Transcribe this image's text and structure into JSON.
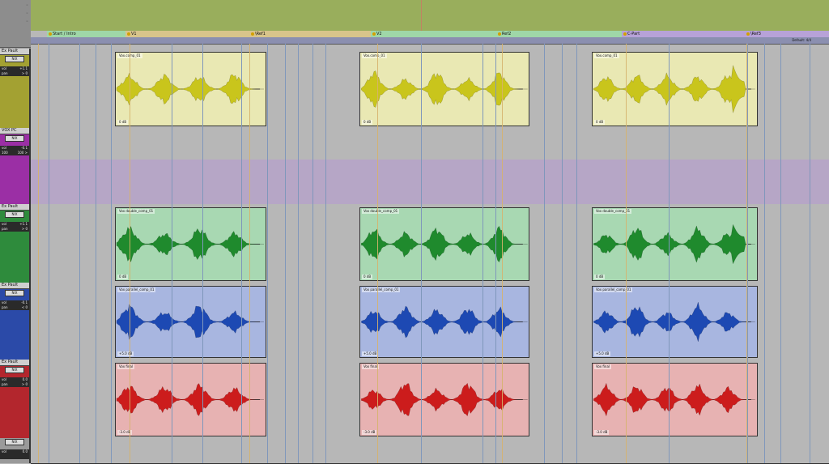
{
  "header": {
    "button_a": "◦",
    "button_b": "◦",
    "button_c": "◦"
  },
  "markers": [
    {
      "label": "Start / Intro",
      "color": "#9fd7a8"
    },
    {
      "label": "V1",
      "color": "#d8c48b"
    },
    {
      "label": "\\Ref1",
      "color": "#d8c48b"
    },
    {
      "label": "V2",
      "color": "#9fd7a8"
    },
    {
      "label": "Ref2",
      "color": "#9fd7a8"
    },
    {
      "label": "C-Part",
      "color": "#b7a2d8"
    },
    {
      "label": "\\Ref3",
      "color": "#b7a2d8"
    }
  ],
  "bar_label": "Default: 4/4",
  "tracks": [
    {
      "name": "Ex Pault",
      "mode": "NIX",
      "vol_label": "vol",
      "vol": "+1.1",
      "pan_label": "pan",
      "pan": "> 0",
      "color": "#a3a132",
      "lane_bg": "#b7b7b7"
    },
    {
      "name": "VOX PC",
      "mode": "NIX",
      "vol_label": "vol",
      "vol": "-0.1",
      "pan_label": "100",
      "pan": "100 >",
      "color": "#9b2fa5",
      "lane_bg": "#b7b7b7"
    },
    {
      "name": "",
      "mode": "",
      "vol_label": "",
      "vol": "",
      "pan_label": "",
      "pan": "",
      "color": "#9b2fa5",
      "lane_bg": "#b6a6c6"
    },
    {
      "name": "Ex Pault",
      "mode": "NIX",
      "vol_label": "vol",
      "vol": "+1.1",
      "pan_label": "pan",
      "pan": "> 0",
      "color": "#2e8b3c",
      "lane_bg": "#b7b7b7"
    },
    {
      "name": "Ex Pault",
      "mode": "NIX",
      "vol_label": "vol",
      "vol": "-0.1",
      "pan_label": "pan",
      "pan": "< 0",
      "color": "#2b4aa8",
      "lane_bg": "#b7b7b7"
    },
    {
      "name": "Ex Pault",
      "mode": "NIX",
      "vol_label": "vol",
      "vol": "0.0",
      "pan_label": "pan",
      "pan": "> 0",
      "color": "#b3262d",
      "lane_bg": "#b7b7b7"
    },
    {
      "name": "",
      "mode": "NIX",
      "vol_label": "vol",
      "vol": "0.0",
      "pan_label": "",
      "pan": "",
      "color": "#9a9a9a",
      "lane_bg": "#b7b7b7"
    }
  ],
  "clips": {
    "yellow": [
      {
        "name": "Vox.comp_01",
        "gain": "0 dB",
        "fill": "#e9e8b3",
        "wave": "#c9c51c"
      },
      {
        "name": "Vox.comp_01",
        "gain": "0 dB",
        "fill": "#e9e8b3",
        "wave": "#c9c51c"
      },
      {
        "name": "Vox.comp_01",
        "gain": "0 dB",
        "fill": "#e9e8b3",
        "wave": "#c9c51c"
      }
    ],
    "green": [
      {
        "name": "Vox double_comp_01",
        "gain": "0 dB",
        "fill": "#a8d8b2",
        "wave": "#1f8a2d"
      },
      {
        "name": "Vox double_comp_01",
        "gain": "0 dB",
        "fill": "#a8d8b2",
        "wave": "#1f8a2d"
      },
      {
        "name": "Vox double_comp_01",
        "gain": "0 dB",
        "fill": "#a8d8b2",
        "wave": "#1f8a2d"
      }
    ],
    "blue": [
      {
        "name": "Vox parallel_comp_01",
        "gain": "+5.0 dB",
        "fill": "#a8b6e0",
        "wave": "#1d49b3"
      },
      {
        "name": "Vox parallel_comp_01",
        "gain": "+5.0 dB",
        "fill": "#a8b6e0",
        "wave": "#1d49b3"
      },
      {
        "name": "Vox parallel_comp_01",
        "gain": "+5.0 dB",
        "fill": "#a8b6e0",
        "wave": "#1d49b3"
      }
    ],
    "red": [
      {
        "name": "Vox final",
        "gain": "-3.0 dB",
        "fill": "#e7b2b2",
        "wave": "#cc1c1c"
      },
      {
        "name": "Vox final",
        "gain": "-3.0 dB",
        "fill": "#e7b2b2",
        "wave": "#cc1c1c"
      },
      {
        "name": "Vox final",
        "gain": "-3.0 dB",
        "fill": "#e7b2b2",
        "wave": "#cc1c1c"
      }
    ]
  },
  "colors": {
    "top_strip": "#99ae5c",
    "grid_line": "#7f97bb",
    "marker_line": "#d6b36b",
    "background": "#b8b8b8"
  }
}
